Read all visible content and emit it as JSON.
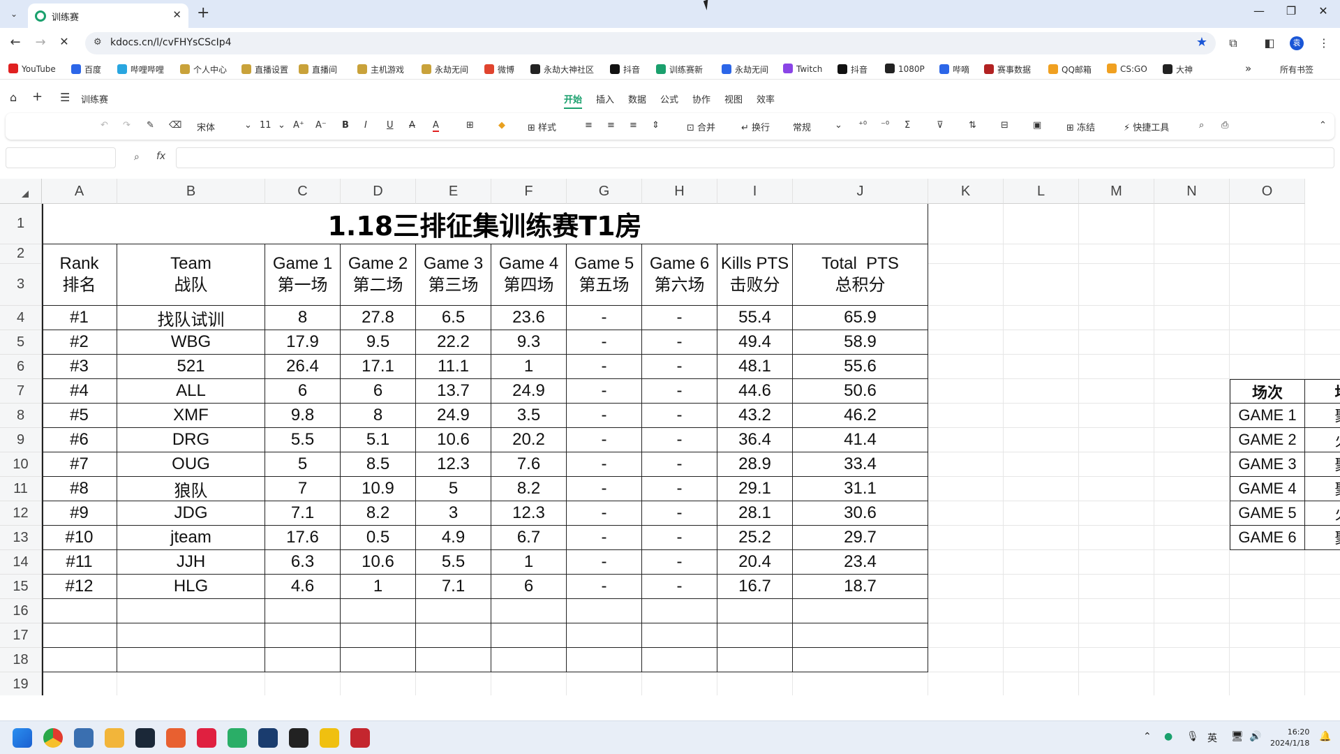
{
  "browser": {
    "tab_title": "训练赛",
    "url": "kdocs.cn/l/cvFHYsCScIp4",
    "bookmarks": [
      "YouTube",
      "百度",
      "哔哩哔哩",
      "个人中心",
      "直播设置",
      "直播间",
      "主机游戏",
      "永劫无间",
      "微博",
      "永劫大神社区",
      "抖音",
      "训练赛新",
      "永劫无间",
      "Twitch",
      "抖音",
      "1080P",
      "哔嘀",
      "赛事数据",
      "QQ邮箱",
      "CS:GO",
      "大神"
    ],
    "bookmark_colors": [
      "#e02020",
      "#2c66e8",
      "#29a6e0",
      "#c9a23a",
      "#c9a23a",
      "#c9a23a",
      "#c9a23a",
      "#c9a23a",
      "#e0442e",
      "#222222",
      "#111111",
      "#1aa06d",
      "#2c66e8",
      "#8a45e6",
      "#111111",
      "#222222",
      "#2c66e8",
      "#b22222",
      "#f0a020",
      "#f0a020",
      "#222222"
    ],
    "all_bookmarks": "所有书签",
    "profile": "袁"
  },
  "app": {
    "doc_name": "训练赛",
    "menus": [
      "开始",
      "插入",
      "数据",
      "公式",
      "协作",
      "视图",
      "效率"
    ],
    "active_menu": "开始",
    "toolbar": {
      "font": "宋体",
      "size": "11",
      "style": "样式",
      "merge": "合并",
      "wrap": "换行",
      "format": "常规",
      "freeze": "冻结",
      "quick_tools": "快捷工具"
    },
    "fx": "fx"
  },
  "sheet": {
    "columns": [
      "A",
      "B",
      "C",
      "D",
      "E",
      "F",
      "G",
      "H",
      "I",
      "J",
      "K",
      "L",
      "M",
      "N",
      "O"
    ],
    "rows": [
      "1",
      "2",
      "3",
      "4",
      "5",
      "6",
      "7",
      "8",
      "9",
      "10",
      "11",
      "12",
      "13",
      "14",
      "15",
      "16",
      "17",
      "18",
      "19"
    ],
    "title": "1.18三排征集训练赛T1房",
    "headers": [
      {
        "en": "Rank",
        "cn": "排名"
      },
      {
        "en": "Team",
        "cn": "战队"
      },
      {
        "en": "Game 1",
        "cn": "第一场"
      },
      {
        "en": "Game 2",
        "cn": "第二场"
      },
      {
        "en": "Game 3",
        "cn": "第三场"
      },
      {
        "en": "Game 4",
        "cn": "第四场"
      },
      {
        "en": "Game 5",
        "cn": "第五场"
      },
      {
        "en": "Game 6",
        "cn": "第六场"
      },
      {
        "en": "Kills PTS",
        "cn": "击败分"
      },
      {
        "en": "Total  PTS",
        "cn": "总积分"
      }
    ],
    "data": [
      [
        "#1",
        "找队试训",
        "8",
        "27.8",
        "6.5",
        "23.6",
        "-",
        "-",
        "55.4",
        "65.9"
      ],
      [
        "#2",
        "WBG",
        "17.9",
        "9.5",
        "22.2",
        "9.3",
        "-",
        "-",
        "49.4",
        "58.9"
      ],
      [
        "#3",
        "521",
        "26.4",
        "17.1",
        "11.1",
        "1",
        "-",
        "-",
        "48.1",
        "55.6"
      ],
      [
        "#4",
        "ALL",
        "6",
        "6",
        "13.7",
        "24.9",
        "-",
        "-",
        "44.6",
        "50.6"
      ],
      [
        "#5",
        "XMF",
        "9.8",
        "8",
        "24.9",
        "3.5",
        "-",
        "-",
        "43.2",
        "46.2"
      ],
      [
        "#6",
        "DRG",
        "5.5",
        "5.1",
        "10.6",
        "20.2",
        "-",
        "-",
        "36.4",
        "41.4"
      ],
      [
        "#7",
        "OUG",
        "5",
        "8.5",
        "12.3",
        "7.6",
        "-",
        "-",
        "28.9",
        "33.4"
      ],
      [
        "#8",
        "狼队",
        "7",
        "10.9",
        "5",
        "8.2",
        "-",
        "-",
        "29.1",
        "31.1"
      ],
      [
        "#9",
        "JDG",
        "7.1",
        "8.2",
        "3",
        "12.3",
        "-",
        "-",
        "28.1",
        "30.6"
      ],
      [
        "#10",
        "jteam",
        "17.6",
        "0.5",
        "4.9",
        "6.7",
        "-",
        "-",
        "25.2",
        "29.7"
      ],
      [
        "#11",
        "JJH",
        "6.3",
        "10.6",
        "5.5",
        "1",
        "-",
        "-",
        "20.4",
        "23.4"
      ],
      [
        "#12",
        "HLG",
        "4.6",
        "1",
        "7.1",
        "6",
        "-",
        "-",
        "16.7",
        "18.7"
      ]
    ],
    "side_table": {
      "header": [
        "场次",
        "地"
      ],
      "rows": [
        [
          "GAME 1",
          "聚"
        ],
        [
          "GAME 2",
          "火"
        ],
        [
          "GAME 3",
          "聚"
        ],
        [
          "GAME 4",
          "聚"
        ],
        [
          "GAME 5",
          "火"
        ],
        [
          "GAME 6",
          "聚"
        ]
      ]
    }
  },
  "taskbar": {
    "apps": [
      "windows-start",
      "chrome",
      "app-blue",
      "file-explorer",
      "steam",
      "app-game",
      "netease-music",
      "wechat",
      "app-ring",
      "app-black",
      "app-yellow",
      "app-red"
    ],
    "app_colors": [
      "#1e78e0",
      "#e23b2e",
      "#3a6fb0",
      "#f2b53a",
      "#1b2838",
      "#e86030",
      "#e02040",
      "#2aae67",
      "#1a3c6e",
      "#222222",
      "#f0c010",
      "#c4262e"
    ],
    "ime": "英",
    "time": "16:20",
    "date": "2024/1/18"
  }
}
